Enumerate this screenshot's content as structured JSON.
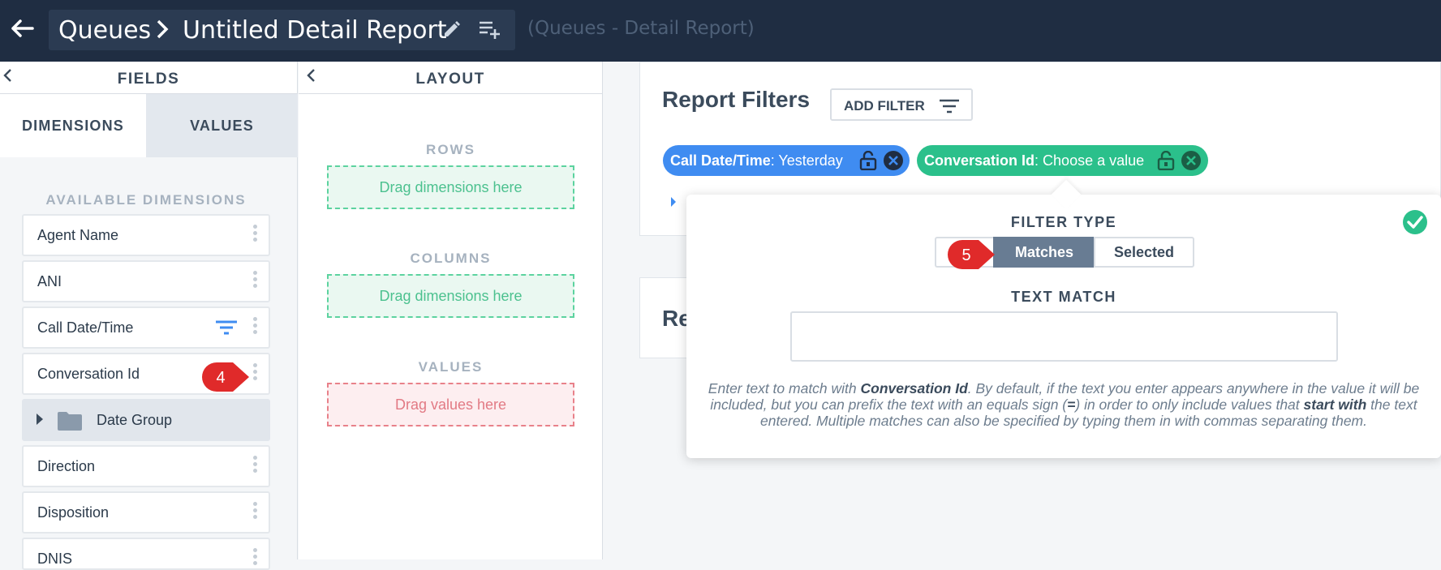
{
  "header": {
    "breadcrumb_root": "Queues",
    "breadcrumb_current": "Untitled Detail Report",
    "subtitle": "(Queues - Detail Report)",
    "bg_color": "#1f2d42"
  },
  "fields_panel": {
    "title": "FIELDS",
    "tabs": [
      "DIMENSIONS",
      "VALUES"
    ],
    "active_tab": "DIMENSIONS",
    "available_label": "AVAILABLE DIMENSIONS",
    "items": [
      {
        "label": "Agent Name"
      },
      {
        "label": "ANI"
      },
      {
        "label": "Call Date/Time",
        "has_filter_icon": true
      },
      {
        "label": "Conversation Id"
      },
      {
        "label": "Date Group",
        "is_group": true
      },
      {
        "label": "Direction"
      },
      {
        "label": "Disposition"
      },
      {
        "label": "DNIS"
      }
    ]
  },
  "layout_panel": {
    "title": "LAYOUT",
    "rows_label": "ROWS",
    "rows_drop": "Drag dimensions here",
    "columns_label": "COLUMNS",
    "columns_drop": "Drag dimensions here",
    "values_label": "VALUES",
    "values_drop": "Drag values here"
  },
  "report_filters": {
    "title": "Report Filters",
    "add_filter_label": "ADD FILTER",
    "chips": [
      {
        "field": "Call Date/Time",
        "value": "Yesterday",
        "color": "#3f8cf1"
      },
      {
        "field": "Conversation Id",
        "value": "Choose a value",
        "color": "#2bc08b"
      }
    ],
    "second_card_title": "Re"
  },
  "popover": {
    "filter_type_label": "FILTER TYPE",
    "options": [
      "Matches",
      "Selected"
    ],
    "selected_option": "Matches",
    "text_match_label": "TEXT MATCH",
    "text_value": "",
    "help_pre": "Enter text to match with ",
    "help_field": "Conversation Id",
    "help_mid": ". By default, if the text you enter appears anywhere in the value it will be included, but you can prefix the text with an equals sign (",
    "help_eq": "=",
    "help_mid2": ") in order to only include values that ",
    "help_strong": "start with",
    "help_post": " the text entered. Multiple matches can also be specified by typing them in with commas separating them."
  },
  "markers": [
    "4",
    "5"
  ]
}
